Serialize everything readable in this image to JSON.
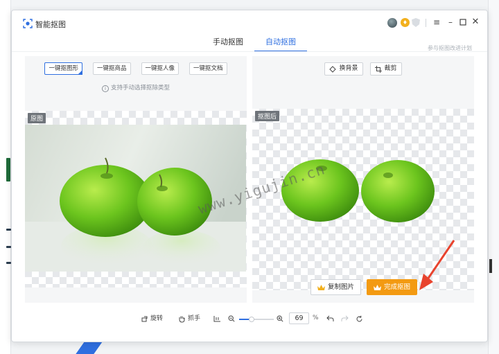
{
  "window": {
    "app_title": "智能抠图",
    "join_link": "参与抠图改进计划"
  },
  "tabs": [
    {
      "label": "手动抠图",
      "active": false
    },
    {
      "label": "自动抠图",
      "active": true
    }
  ],
  "left_panel": {
    "mode_buttons": [
      {
        "label": "一键抠图形",
        "selected": true
      },
      {
        "label": "一键抠商品",
        "selected": false
      },
      {
        "label": "一键抠人像",
        "selected": false
      },
      {
        "label": "一键抠文档",
        "selected": false
      }
    ],
    "hint": "支持手动选择抠除类型",
    "tag": "原图"
  },
  "right_panel": {
    "tools": [
      {
        "label": "换背景",
        "icon": "background-swap-icon"
      },
      {
        "label": "裁剪",
        "icon": "crop-icon"
      }
    ],
    "tag": "抠图后",
    "copy_button": "复制图片",
    "done_button": "完成抠图"
  },
  "watermark": "www.yigujin.cn",
  "bottom_bar": {
    "rotate": "旋转",
    "grab": "抓手",
    "zoom_value": "69",
    "zoom_unit": "%",
    "zoom_level": 0.35
  },
  "colors": {
    "accent": "#2f6fe0",
    "primary_action": "#f39a12",
    "vip": "#f2b01e"
  }
}
